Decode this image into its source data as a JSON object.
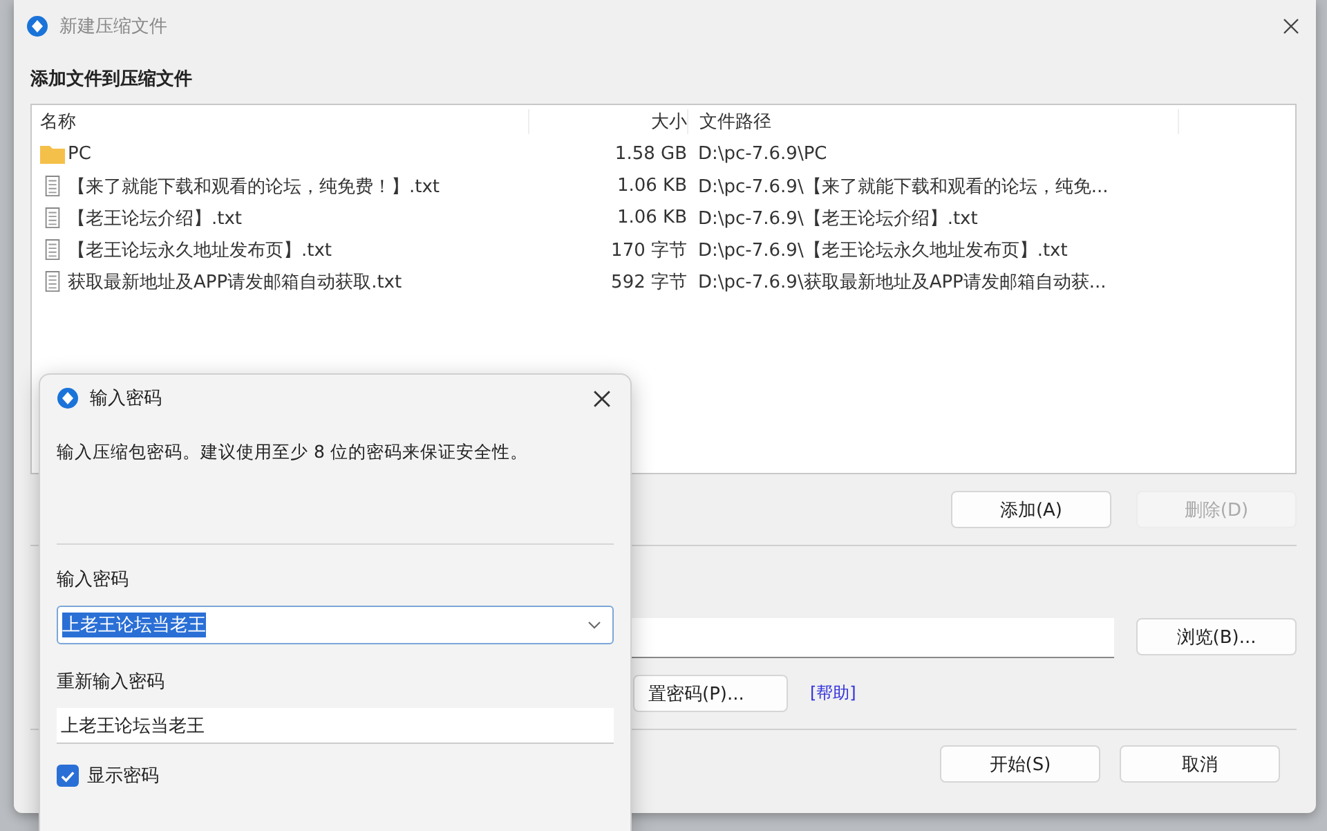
{
  "window": {
    "title": "新建压缩文件"
  },
  "section_title": "添加文件到压缩文件",
  "file_list": {
    "columns": [
      "名称",
      "大小",
      "文件路径"
    ],
    "rows": [
      {
        "kind": "folder",
        "name": "PC",
        "size": "1.58 GB",
        "path": "D:\\pc-7.6.9\\PC"
      },
      {
        "kind": "file",
        "name": "【来了就能下载和观看的论坛，纯免费！】.txt",
        "size": "1.06 KB",
        "path": "D:\\pc-7.6.9\\【来了就能下载和观看的论坛，纯免..."
      },
      {
        "kind": "file",
        "name": "【老王论坛介绍】.txt",
        "size": "1.06 KB",
        "path": "D:\\pc-7.6.9\\【老王论坛介绍】.txt"
      },
      {
        "kind": "file",
        "name": "【老王论坛永久地址发布页】.txt",
        "size": "170 字节",
        "path": "D:\\pc-7.6.9\\【老王论坛永久地址发布页】.txt"
      },
      {
        "kind": "file",
        "name": "获取最新地址及APP请发邮箱自动获取.txt",
        "size": "592 字节",
        "path": "D:\\pc-7.6.9\\获取最新地址及APP请发邮箱自动获..."
      }
    ]
  },
  "list_buttons": [
    {
      "label": "添加(A)",
      "disabled": false
    },
    {
      "label": "删除(D)",
      "disabled": true
    }
  ],
  "browse_button": "浏览(B)...",
  "password_button": "置密码(P)...",
  "help_link": "[帮助]",
  "footer_buttons": [
    "开始(S)",
    "取消"
  ],
  "password_dialog": {
    "title": "输入密码",
    "message": "输入压缩包密码。建议使用至少 8 位的密码来保证安全性。",
    "fields": [
      {
        "kind": "combo",
        "label": "输入密码",
        "value": "上老王论坛当老王",
        "text_selected": true
      },
      {
        "kind": "text",
        "label": "重新输入密码",
        "value": "上老王论坛当老王",
        "text_selected": false
      }
    ],
    "show_password": {
      "label": "显示密码",
      "checked": true
    }
  }
}
